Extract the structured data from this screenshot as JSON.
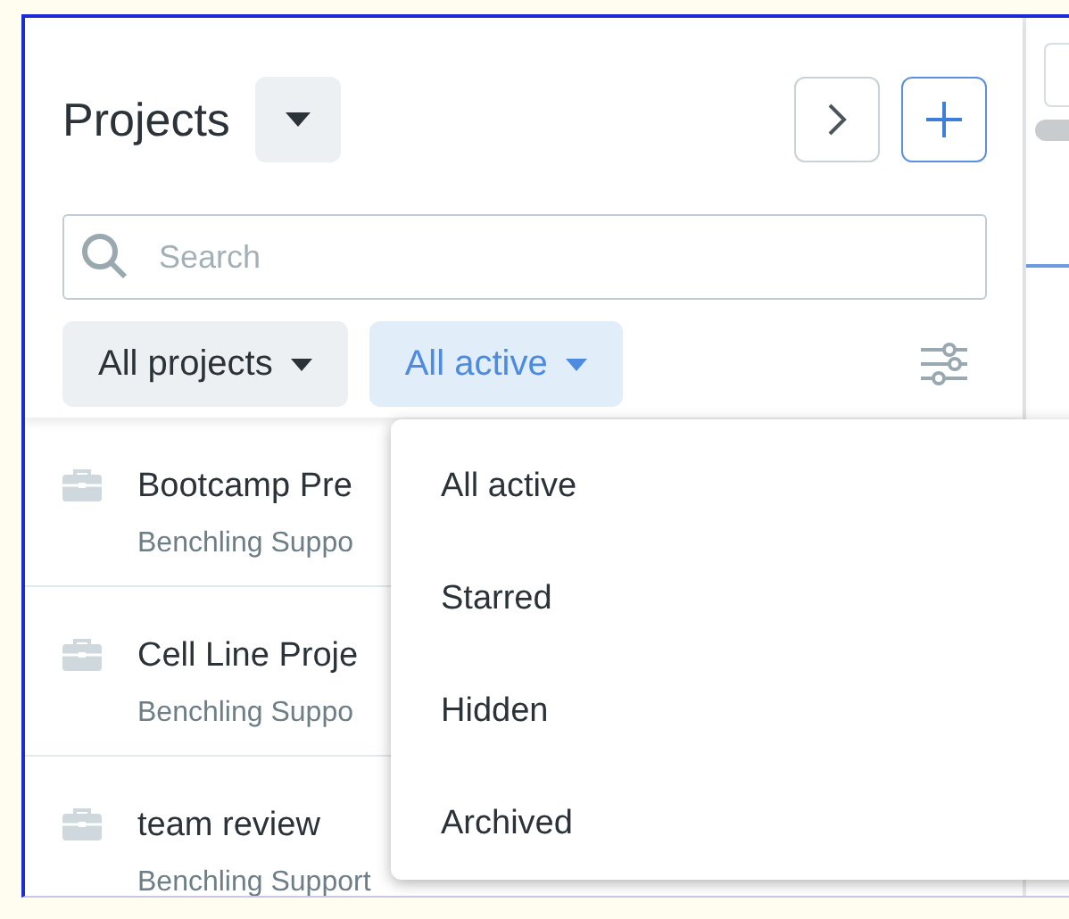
{
  "header": {
    "title": "Projects"
  },
  "search": {
    "placeholder": "Search"
  },
  "filters": [
    {
      "label": "All projects",
      "selected": false
    },
    {
      "label": "All active",
      "selected": true
    }
  ],
  "projects": [
    {
      "name": "Bootcamp Pre",
      "owner": "Benchling Suppo"
    },
    {
      "name": "Cell Line Proje",
      "owner": "Benchling Suppo"
    },
    {
      "name": "team review",
      "owner": "Benchling Support"
    }
  ],
  "dropdown": {
    "items": [
      {
        "label": "All active"
      },
      {
        "label": "Starred"
      },
      {
        "label": "Hidden"
      },
      {
        "label": "Archived"
      }
    ]
  }
}
